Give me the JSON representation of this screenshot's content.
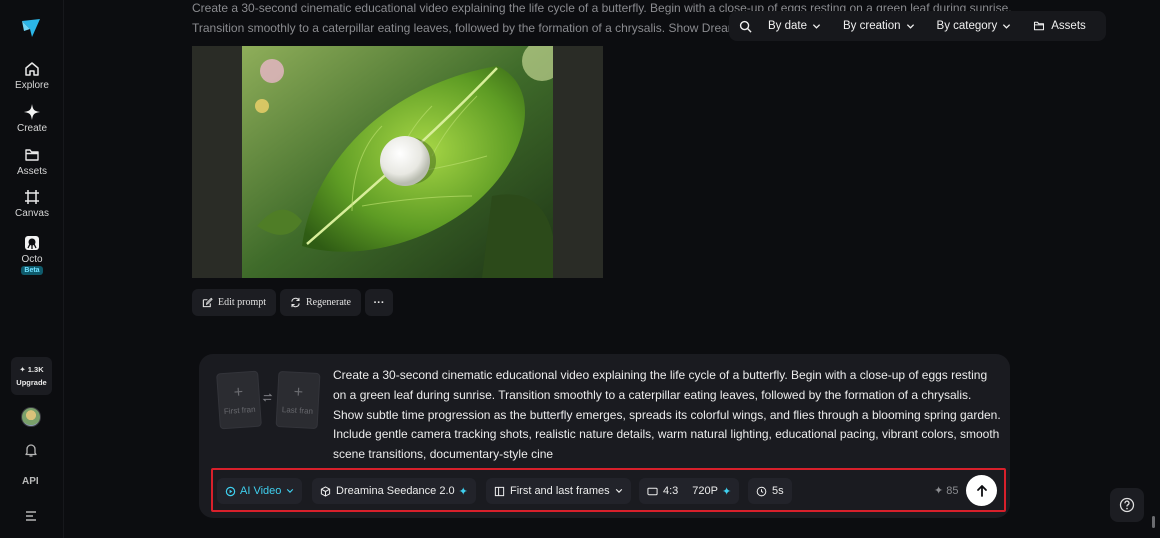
{
  "sidebar": {
    "items": [
      {
        "label": "Explore",
        "icon": "home-icon"
      },
      {
        "label": "Create",
        "icon": "sparkle-icon"
      },
      {
        "label": "Assets",
        "icon": "folder-icon"
      },
      {
        "label": "Canvas",
        "icon": "canvas-icon"
      },
      {
        "label": "Octo",
        "icon": "octo-icon",
        "badge": "Beta"
      }
    ],
    "credits": "1.3K",
    "upgrade_label": "Upgrade",
    "api_label": "API"
  },
  "top_prompt": "Create a 30-second cinematic educational video explaining the life cycle of a butterfly. Begin with a close-up of eggs resting on a green leaf during sunrise. Transition smoothly to a caterpillar eating leaves, followed by the formation of a chrysalis. Show     Dream",
  "filters": {
    "by_date": "By date",
    "by_creation": "By creation",
    "by_category": "By category",
    "assets": "Assets"
  },
  "actions": {
    "edit_prompt": "Edit prompt",
    "regenerate": "Regenerate",
    "more": "···"
  },
  "composer": {
    "first_frame": "First fran",
    "last_frame": "Last fran",
    "prompt": "Create a 30-second cinematic educational video explaining the life cycle of a butterfly. Begin with a close-up of eggs resting on a green leaf during sunrise. Transition smoothly to a caterpillar eating leaves, followed by the formation of a chrysalis. Show subtle time progression as the butterfly emerges, spreads its colorful wings, and flies through a blooming spring garden. Include gentle camera tracking shots, realistic nature details, warm natural lighting, educational pacing, vibrant colors, smooth scene transitions, documentary-style cine"
  },
  "toolbar": {
    "mode": "AI Video",
    "model": "Dreamina Seedance 2.0",
    "frames_mode": "First and last frames",
    "ratio": "4:3",
    "resolution": "720P",
    "duration": "5s",
    "cost": "85"
  },
  "colors": {
    "accent": "#3fd0ef",
    "highlight_border": "#d8202b",
    "background": "#0c0d10"
  }
}
